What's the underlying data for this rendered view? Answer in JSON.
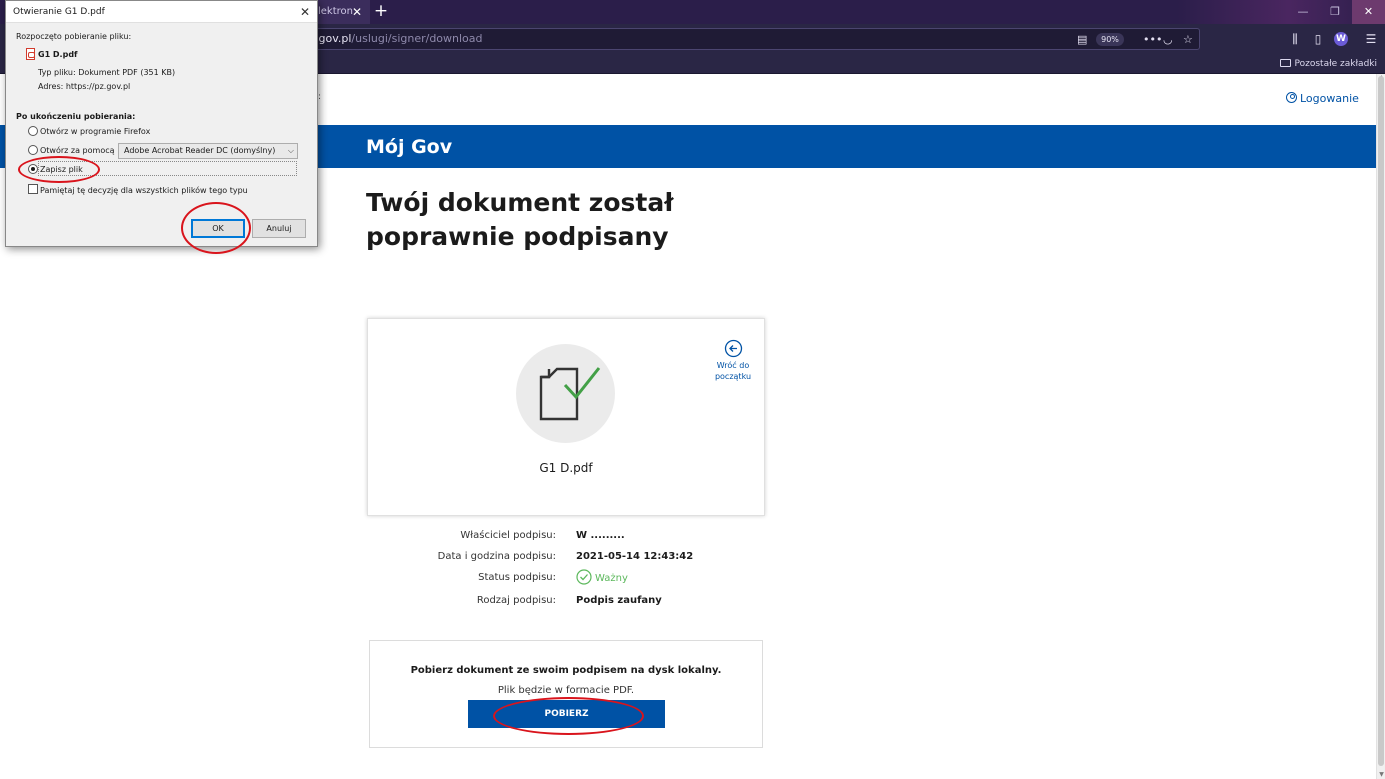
{
  "browser": {
    "tab_partial_label": "lektron",
    "tab_close_glyph": "✕",
    "new_tab_glyph": "+",
    "url_host": ".gov.pl",
    "url_path": "/uslugi/signer/download",
    "zoom": "90%",
    "bookmarks_other": "Pozostałe zakładki",
    "icons": [
      "reader-view-icon",
      "page-actions-icon",
      "pocket-icon",
      "bookmark-star-icon",
      "library-icon",
      "sidebar-icon",
      "extension-w-icon",
      "menu-icon"
    ],
    "window_controls": {
      "minimize": "—",
      "restore": "❐",
      "close": "✕"
    }
  },
  "page": {
    "login_label": "Logowanie",
    "banner_title": "Mój Gov",
    "heading": "Twój dokument został poprawnie podpisany",
    "document_name": "G1 D.pdf",
    "back_link": "Wróć do początku",
    "signature_info": [
      {
        "label": "Właściciel podpisu:",
        "value": "W ........."
      },
      {
        "label": "Data i godzina podpisu:",
        "value": "2021-05-14 12:43:42"
      },
      {
        "label": "Status podpisu:",
        "value": "Ważny"
      },
      {
        "label": "Rodzaj podpisu:",
        "value": "Podpis zaufany"
      }
    ],
    "download": {
      "title": "Pobierz dokument ze swoim podpisem na dysk lokalny.",
      "subtitle": "Plik będzie w formacie PDF.",
      "button": "POBIERZ"
    },
    "colors": {
      "brand": "#0052a5",
      "valid": "#5cb85c",
      "annotation": "#d9141c"
    }
  },
  "dialog": {
    "title": "Otwieranie G1 D.pdf",
    "close_glyph": "✕",
    "started_label": "Rozpoczęto pobieranie pliku:",
    "file_name": "G1 D.pdf",
    "file_type": "Typ pliku:  Dokument PDF (351 KB)",
    "address": "Adres:  https://pz.gov.pl",
    "after_label": "Po ukończeniu pobierania:",
    "options": {
      "open_firefox": "Otwórz w programie Firefox",
      "open_with": "Otwórz za pomocą",
      "open_with_app": "Adobe Acrobat Reader DC (domyślny)",
      "save_file": "Zapisz plik",
      "selected": "save_file"
    },
    "remember": "Pamiętaj tę decyzję dla wszystkich plików tego typu",
    "ok": "OK",
    "cancel": "Anuluj"
  }
}
